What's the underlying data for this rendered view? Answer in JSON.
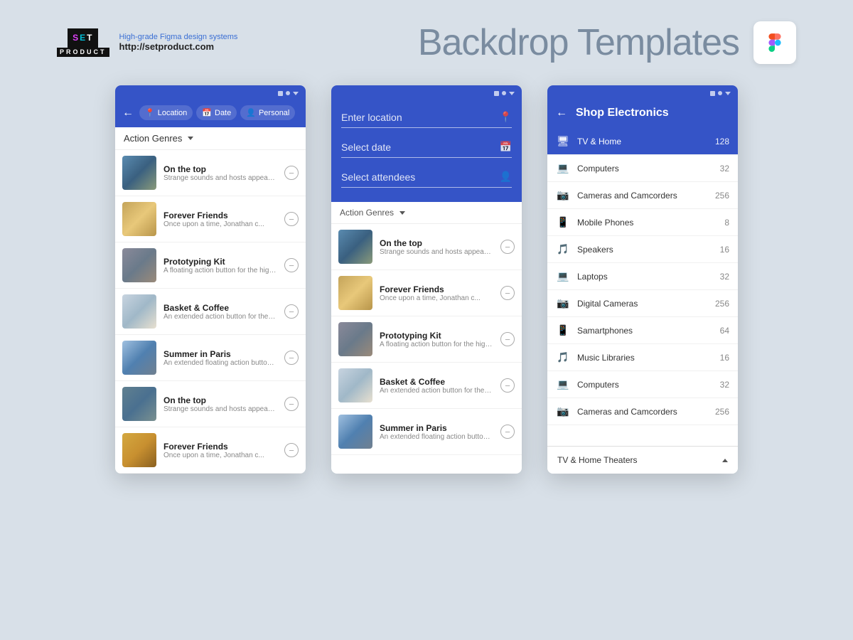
{
  "header": {
    "brand_name": "SET\nPRODUCT",
    "tagline": "High-grade Figma design systems",
    "url": "http://setproduct.com",
    "title": "Backdrop Templates"
  },
  "phone1": {
    "nav": {
      "back": "←",
      "tabs": [
        {
          "icon": "location",
          "label": "Location"
        },
        {
          "icon": "calendar",
          "label": "Date"
        },
        {
          "icon": "person",
          "label": "Personal"
        }
      ]
    },
    "filter": "Action Genres",
    "items": [
      {
        "title": "On the top",
        "desc": "Strange sounds and hosts appeared from somewhere an...",
        "thumb": "aerial"
      },
      {
        "title": "Forever Friends",
        "desc": "Once upon a time, Jonathan c...",
        "thumb": "silhouette"
      },
      {
        "title": "Prototyping Kit",
        "desc": "A floating action button for the highest emphasis",
        "thumb": "texture"
      },
      {
        "title": "Basket & Coffee",
        "desc": "An extended action button for the highest emphasis",
        "thumb": "cafe"
      },
      {
        "title": "Summer in Paris",
        "desc": "An extended floating action button for emphasis",
        "thumb": "paris"
      },
      {
        "title": "On the top",
        "desc": "Strange sounds and hosts appeared from somewhere an...",
        "thumb": "aerial2"
      },
      {
        "title": "Forever Friends",
        "desc": "Once upon a time, Jonathan c...",
        "thumb": "silhouette2"
      }
    ]
  },
  "phone2": {
    "fields": [
      {
        "placeholder": "Enter location",
        "icon": "📍"
      },
      {
        "placeholder": "Select date",
        "icon": "📅"
      },
      {
        "placeholder": "Select attendees",
        "icon": "👤"
      }
    ],
    "filter": "Action Genres",
    "items": [
      {
        "title": "On the top",
        "desc": "Strange sounds and hosts appeared from somewhere an...",
        "thumb": "aerial"
      },
      {
        "title": "Forever Friends",
        "desc": "Once upon a time, Jonathan c...",
        "thumb": "silhouette"
      },
      {
        "title": "Prototyping Kit",
        "desc": "A floating action button for the highest emphasis",
        "thumb": "texture"
      },
      {
        "title": "Basket & Coffee",
        "desc": "An extended action button for the highest emphasis",
        "thumb": "cafe"
      },
      {
        "title": "Summer in Paris",
        "desc": "An extended floating action button for emphasis",
        "thumb": "paris"
      }
    ]
  },
  "phone3": {
    "header_title": "Shop Electronics",
    "back": "←",
    "categories": [
      {
        "icon": "tv",
        "label": "TV & Home",
        "count": 128,
        "active": true
      },
      {
        "icon": "laptop",
        "label": "Computers",
        "count": 32,
        "active": false
      },
      {
        "icon": "camera",
        "label": "Cameras and Camcorders",
        "count": 256,
        "active": false
      },
      {
        "icon": "phone",
        "label": "Mobile Phones",
        "count": 8,
        "active": false
      },
      {
        "icon": "music",
        "label": "Speakers",
        "count": 16,
        "active": false
      },
      {
        "icon": "laptop",
        "label": "Laptops",
        "count": 32,
        "active": false
      },
      {
        "icon": "camera",
        "label": "Digital Cameras",
        "count": 256,
        "active": false
      },
      {
        "icon": "phone",
        "label": "Samartphones",
        "count": 64,
        "active": false
      },
      {
        "icon": "music",
        "label": "Music Libraries",
        "count": 16,
        "active": false
      },
      {
        "icon": "laptop",
        "label": "Computers",
        "count": 32,
        "active": false
      },
      {
        "icon": "camera",
        "label": "Cameras and Camcorders",
        "count": 256,
        "active": false
      }
    ],
    "footer": "TV & Home Theaters"
  }
}
